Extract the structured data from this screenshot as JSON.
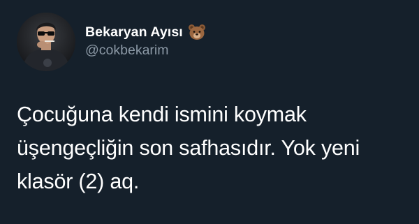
{
  "author": {
    "display_name": "Bekaryan Ayısı",
    "name_emoji": "bear-face-icon",
    "handle": "@cokbekarim",
    "avatar": "profile-photo-person-with-sunglasses"
  },
  "tweet": {
    "text": "Çocuğuna kendi ismini koymak\nüşengeçliğin son safhasıdır. Yok yeni\nklasör (2) aq."
  },
  "colors": {
    "background": "#15202b",
    "text_primary": "#ffffff",
    "text_secondary": "#8b98a5"
  }
}
